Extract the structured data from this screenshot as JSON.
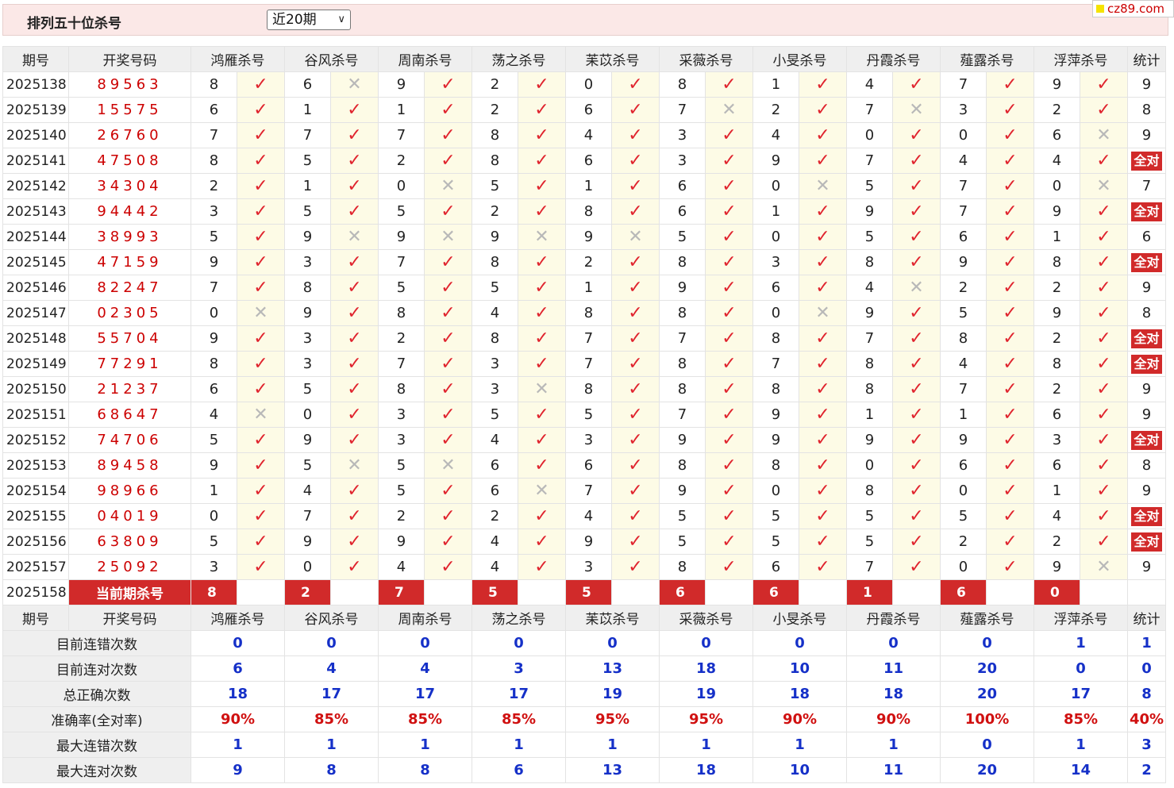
{
  "header": {
    "title": "排列五十位杀号",
    "range_selected": "近20期",
    "logo_text": "cz89.com"
  },
  "columns": [
    "期号",
    "开奖号码",
    "鸿雁杀号",
    "谷风杀号",
    "周南杀号",
    "荡之杀号",
    "苿苡杀号",
    "采薇杀号",
    "小旻杀号",
    "丹霞杀号",
    "薤露杀号",
    "浮萍杀号",
    "统计"
  ],
  "rows": [
    {
      "period": "2025138",
      "draw": "89563",
      "kills": [
        "8",
        "6",
        "9",
        "2",
        "0",
        "8",
        "1",
        "4",
        "7",
        "9"
      ],
      "hits": [
        1,
        0,
        1,
        1,
        1,
        1,
        1,
        1,
        1,
        1
      ],
      "stat": "9"
    },
    {
      "period": "2025139",
      "draw": "15575",
      "kills": [
        "6",
        "1",
        "1",
        "2",
        "6",
        "7",
        "2",
        "7",
        "3",
        "2"
      ],
      "hits": [
        1,
        1,
        1,
        1,
        1,
        0,
        1,
        0,
        1,
        1
      ],
      "stat": "8"
    },
    {
      "period": "2025140",
      "draw": "26760",
      "kills": [
        "7",
        "7",
        "7",
        "8",
        "4",
        "3",
        "4",
        "0",
        "0",
        "6"
      ],
      "hits": [
        1,
        1,
        1,
        1,
        1,
        1,
        1,
        1,
        1,
        0
      ],
      "stat": "9"
    },
    {
      "period": "2025141",
      "draw": "47508",
      "kills": [
        "8",
        "5",
        "2",
        "8",
        "6",
        "3",
        "9",
        "7",
        "4",
        "4"
      ],
      "hits": [
        1,
        1,
        1,
        1,
        1,
        1,
        1,
        1,
        1,
        1
      ],
      "stat": "全对"
    },
    {
      "period": "2025142",
      "draw": "34304",
      "kills": [
        "2",
        "1",
        "0",
        "5",
        "1",
        "6",
        "0",
        "5",
        "7",
        "0"
      ],
      "hits": [
        1,
        1,
        0,
        1,
        1,
        1,
        0,
        1,
        1,
        0
      ],
      "stat": "7"
    },
    {
      "period": "2025143",
      "draw": "94442",
      "kills": [
        "3",
        "5",
        "5",
        "2",
        "8",
        "6",
        "1",
        "9",
        "7",
        "9"
      ],
      "hits": [
        1,
        1,
        1,
        1,
        1,
        1,
        1,
        1,
        1,
        1
      ],
      "stat": "全对"
    },
    {
      "period": "2025144",
      "draw": "38993",
      "kills": [
        "5",
        "9",
        "9",
        "9",
        "9",
        "5",
        "0",
        "5",
        "6",
        "1"
      ],
      "hits": [
        1,
        0,
        0,
        0,
        0,
        1,
        1,
        1,
        1,
        1
      ],
      "stat": "6"
    },
    {
      "period": "2025145",
      "draw": "47159",
      "kills": [
        "9",
        "3",
        "7",
        "8",
        "2",
        "8",
        "3",
        "8",
        "9",
        "8"
      ],
      "hits": [
        1,
        1,
        1,
        1,
        1,
        1,
        1,
        1,
        1,
        1
      ],
      "stat": "全对"
    },
    {
      "period": "2025146",
      "draw": "82247",
      "kills": [
        "7",
        "8",
        "5",
        "5",
        "1",
        "9",
        "6",
        "4",
        "2",
        "2"
      ],
      "hits": [
        1,
        1,
        1,
        1,
        1,
        1,
        1,
        0,
        1,
        1
      ],
      "stat": "9"
    },
    {
      "period": "2025147",
      "draw": "02305",
      "kills": [
        "0",
        "9",
        "8",
        "4",
        "8",
        "8",
        "0",
        "9",
        "5",
        "9"
      ],
      "hits": [
        0,
        1,
        1,
        1,
        1,
        1,
        0,
        1,
        1,
        1
      ],
      "stat": "8"
    },
    {
      "period": "2025148",
      "draw": "55704",
      "kills": [
        "9",
        "3",
        "2",
        "8",
        "7",
        "7",
        "8",
        "7",
        "8",
        "2"
      ],
      "hits": [
        1,
        1,
        1,
        1,
        1,
        1,
        1,
        1,
        1,
        1
      ],
      "stat": "全对"
    },
    {
      "period": "2025149",
      "draw": "77291",
      "kills": [
        "8",
        "3",
        "7",
        "3",
        "7",
        "8",
        "7",
        "8",
        "4",
        "8"
      ],
      "hits": [
        1,
        1,
        1,
        1,
        1,
        1,
        1,
        1,
        1,
        1
      ],
      "stat": "全对"
    },
    {
      "period": "2025150",
      "draw": "21237",
      "kills": [
        "6",
        "5",
        "8",
        "3",
        "8",
        "8",
        "8",
        "8",
        "7",
        "2"
      ],
      "hits": [
        1,
        1,
        1,
        0,
        1,
        1,
        1,
        1,
        1,
        1
      ],
      "stat": "9"
    },
    {
      "period": "2025151",
      "draw": "68647",
      "kills": [
        "4",
        "0",
        "3",
        "5",
        "5",
        "7",
        "9",
        "1",
        "1",
        "6"
      ],
      "hits": [
        0,
        1,
        1,
        1,
        1,
        1,
        1,
        1,
        1,
        1
      ],
      "stat": "9"
    },
    {
      "period": "2025152",
      "draw": "74706",
      "kills": [
        "5",
        "9",
        "3",
        "4",
        "3",
        "9",
        "9",
        "9",
        "9",
        "3"
      ],
      "hits": [
        1,
        1,
        1,
        1,
        1,
        1,
        1,
        1,
        1,
        1
      ],
      "stat": "全对"
    },
    {
      "period": "2025153",
      "draw": "89458",
      "kills": [
        "9",
        "5",
        "5",
        "6",
        "6",
        "8",
        "8",
        "0",
        "6",
        "6"
      ],
      "hits": [
        1,
        0,
        0,
        1,
        1,
        1,
        1,
        1,
        1,
        1
      ],
      "stat": "8"
    },
    {
      "period": "2025154",
      "draw": "98966",
      "kills": [
        "1",
        "4",
        "5",
        "6",
        "7",
        "9",
        "0",
        "8",
        "0",
        "1"
      ],
      "hits": [
        1,
        1,
        1,
        0,
        1,
        1,
        1,
        1,
        1,
        1
      ],
      "stat": "9"
    },
    {
      "period": "2025155",
      "draw": "04019",
      "kills": [
        "0",
        "7",
        "2",
        "2",
        "4",
        "5",
        "5",
        "5",
        "5",
        "4"
      ],
      "hits": [
        1,
        1,
        1,
        1,
        1,
        1,
        1,
        1,
        1,
        1
      ],
      "stat": "全对"
    },
    {
      "period": "2025156",
      "draw": "63809",
      "kills": [
        "5",
        "9",
        "9",
        "4",
        "9",
        "5",
        "5",
        "5",
        "2",
        "2"
      ],
      "hits": [
        1,
        1,
        1,
        1,
        1,
        1,
        1,
        1,
        1,
        1
      ],
      "stat": "全对"
    },
    {
      "period": "2025157",
      "draw": "25092",
      "kills": [
        "3",
        "0",
        "4",
        "4",
        "3",
        "8",
        "6",
        "7",
        "0",
        "9"
      ],
      "hits": [
        1,
        1,
        1,
        1,
        1,
        1,
        1,
        1,
        1,
        0
      ],
      "stat": "9"
    }
  ],
  "current": {
    "period": "2025158",
    "label": "当前期杀号",
    "kills": [
      "8",
      "2",
      "7",
      "5",
      "5",
      "6",
      "6",
      "1",
      "6",
      "0"
    ]
  },
  "stats": [
    {
      "label": "目前连错次数",
      "values": [
        "0",
        "0",
        "0",
        "0",
        "0",
        "0",
        "0",
        "0",
        "0",
        "1",
        "1"
      ]
    },
    {
      "label": "目前连对次数",
      "values": [
        "6",
        "4",
        "4",
        "3",
        "13",
        "18",
        "10",
        "11",
        "20",
        "0",
        "0"
      ]
    },
    {
      "label": "总正确次数",
      "values": [
        "18",
        "17",
        "17",
        "17",
        "19",
        "19",
        "18",
        "18",
        "20",
        "17",
        "8"
      ]
    },
    {
      "label": "准确率(全对率)",
      "values": [
        "90%",
        "85%",
        "85%",
        "85%",
        "95%",
        "95%",
        "90%",
        "90%",
        "100%",
        "85%",
        "40%"
      ],
      "rate": true
    },
    {
      "label": "最大连错次数",
      "values": [
        "1",
        "1",
        "1",
        "1",
        "1",
        "1",
        "1",
        "1",
        "0",
        "1",
        "3"
      ]
    },
    {
      "label": "最大连对次数",
      "values": [
        "9",
        "8",
        "8",
        "6",
        "13",
        "18",
        "10",
        "11",
        "20",
        "14",
        "2"
      ]
    }
  ],
  "symbols": {
    "hit": "✓",
    "miss": "✕"
  },
  "colors": {
    "accent_red": "#d12a2a",
    "num_red": "#cc0000",
    "stat_blue": "#1530c8",
    "header_bg": "#fbe8e7"
  }
}
